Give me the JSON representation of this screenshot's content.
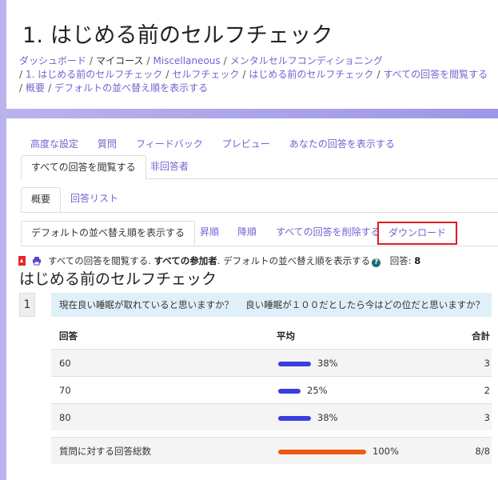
{
  "header": {
    "title": "1. はじめる前のセルフチェック",
    "breadcrumb": [
      "ダッシュボード",
      "マイコース",
      "Miscellaneous",
      "メンタルセルフコンディショニング",
      "1. はじめる前のセルフチェック",
      "セルフチェック",
      "はじめる前のセルフチェック",
      "すべての回答を閲覧する",
      "概要",
      "デフォルトの並べ替え順を表示する"
    ]
  },
  "tabs_row1": [
    "高度な設定",
    "質問",
    "フィードバック",
    "プレビュー",
    "あなたの回答を表示する"
  ],
  "tabs_row2": {
    "active": "すべての回答を閲覧する",
    "other": "非回答者"
  },
  "tabs_row3": {
    "active": "概要",
    "other": "回答リスト"
  },
  "tabs_row4": {
    "active": "デフォルトの並べ替え順を表示する",
    "asc": "昇順",
    "desc": "降順",
    "delete_all": "すべての回答を削除する",
    "download": "ダウンロード"
  },
  "summary": {
    "prefix": "すべての回答を閲覧する. ",
    "participants": "すべての参加者",
    "suffix": ". デフォルトの並べ替え順を表示する",
    "responses_label": "回答:",
    "responses_count": "8"
  },
  "survey_title": "はじめる前のセルフチェック",
  "question": {
    "number": "1",
    "text": "現在良い睡眠が取れていると思いますか？　 良い睡眠が１００だとしたら今はどの位だと思いますか？"
  },
  "results": {
    "headers": {
      "answer": "回答",
      "average": "平均",
      "total": "合計"
    },
    "rows": [
      {
        "answer": "60",
        "percent": "38%",
        "fraction": 0.375,
        "count": "3"
      },
      {
        "answer": "70",
        "percent": "25%",
        "fraction": 0.25,
        "count": "2"
      },
      {
        "answer": "80",
        "percent": "38%",
        "fraction": 0.375,
        "count": "3"
      }
    ],
    "total": {
      "label": "質問に対する回答総数",
      "percent": "100%",
      "fraction": 1.0,
      "count": "8/8"
    }
  },
  "colors": {
    "accent": "#7a5fd1",
    "bar": "#3a3ee0",
    "total_bar": "#ee5a12",
    "highlight": "#e01b24"
  }
}
